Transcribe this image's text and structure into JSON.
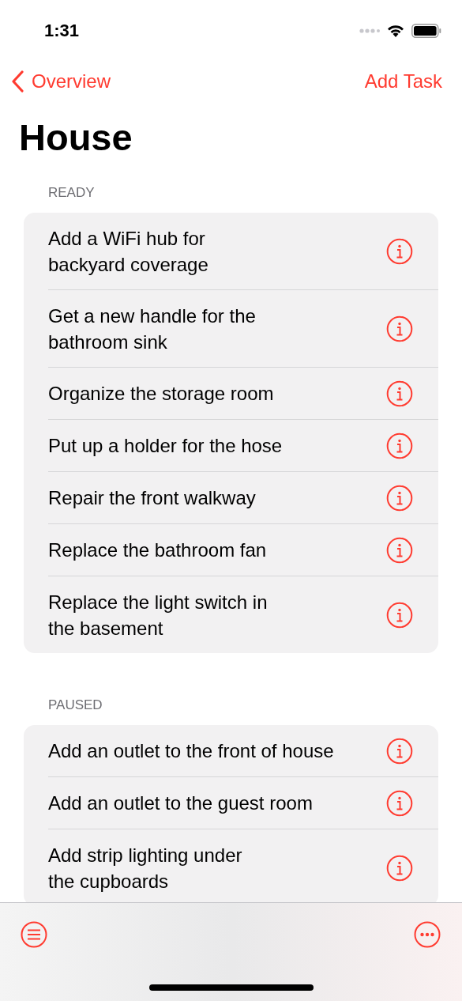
{
  "status_bar": {
    "time": "1:31"
  },
  "nav": {
    "back": "Overview",
    "action": "Add Task"
  },
  "title": "House",
  "sections": [
    {
      "header": "READY",
      "tasks": [
        {
          "lines": [
            "Add a WiFi hub for",
            "backyard coverage"
          ]
        },
        {
          "lines": [
            "Get a new handle for the",
            "bathroom sink"
          ]
        },
        {
          "lines": [
            "Organize the storage room"
          ]
        },
        {
          "lines": [
            "Put up a holder for the hose"
          ]
        },
        {
          "lines": [
            "Repair the front walkway"
          ]
        },
        {
          "lines": [
            "Replace the bathroom fan"
          ]
        },
        {
          "lines": [
            "Replace the light switch in",
            "the basement"
          ]
        }
      ]
    },
    {
      "header": "PAUSED",
      "tasks": [
        {
          "lines": [
            "Add an outlet to the front of house"
          ]
        },
        {
          "lines": [
            "Add an outlet to the guest room"
          ]
        },
        {
          "lines": [
            "Add strip lighting under",
            "the cupboards"
          ]
        }
      ]
    }
  ]
}
